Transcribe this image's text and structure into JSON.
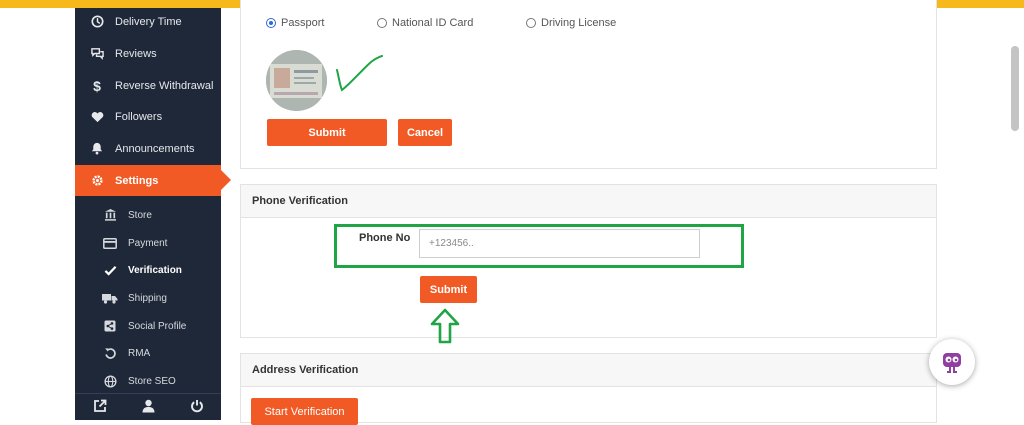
{
  "sidebar": {
    "menu": [
      {
        "label": "Delivery Time",
        "icon": "clock-icon"
      },
      {
        "label": "Reviews",
        "icon": "chat-bubbles-icon"
      },
      {
        "label": "Reverse Withdrawal",
        "icon": "dollar-icon"
      },
      {
        "label": "Followers",
        "icon": "heart-icon"
      },
      {
        "label": "Announcements",
        "icon": "bell-icon"
      },
      {
        "label": "Settings",
        "icon": "gear-icon",
        "active": true
      }
    ],
    "submenu": [
      {
        "label": "Store",
        "icon": "bank-icon"
      },
      {
        "label": "Payment",
        "icon": "credit-card-icon"
      },
      {
        "label": "Verification",
        "icon": "check-icon",
        "current": true
      },
      {
        "label": "Shipping",
        "icon": "truck-icon"
      },
      {
        "label": "Social Profile",
        "icon": "share-icon"
      },
      {
        "label": "RMA",
        "icon": "undo-icon"
      },
      {
        "label": "Store SEO",
        "icon": "globe-icon"
      }
    ],
    "footer_icons": [
      "external-link-icon",
      "user-icon",
      "power-icon"
    ]
  },
  "id_verification": {
    "options": [
      {
        "label": "Passport",
        "selected": true
      },
      {
        "label": "National ID Card",
        "selected": false
      },
      {
        "label": "Driving License",
        "selected": false
      }
    ],
    "submit_label": "Submit",
    "cancel_label": "Cancel"
  },
  "phone_verification": {
    "title": "Phone Verification",
    "label": "Phone No",
    "placeholder": "+123456..",
    "submit_label": "Submit"
  },
  "address_verification": {
    "title": "Address Verification",
    "start_label": "Start Verification"
  },
  "colors": {
    "accent": "#f15a24",
    "sidebar_bg": "#1f2839",
    "top_bar": "#f7b81c",
    "annotation_green": "#1fa545"
  }
}
